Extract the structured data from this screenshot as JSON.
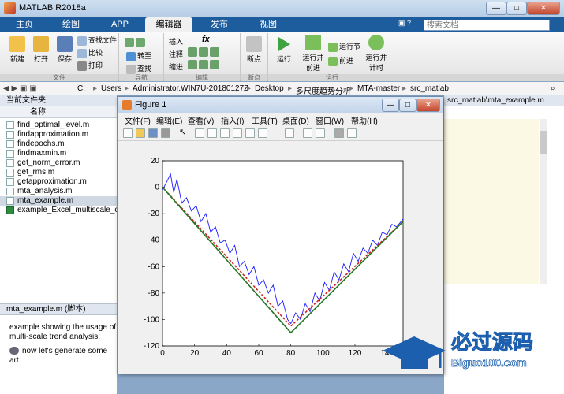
{
  "window": {
    "title": "MATLAB R2018a",
    "min": "—",
    "max": "□",
    "close": "✕"
  },
  "tabs": [
    {
      "label": "主页"
    },
    {
      "label": "绘图"
    },
    {
      "label": "APP"
    },
    {
      "label": "编辑器"
    },
    {
      "label": "发布"
    },
    {
      "label": "视图"
    }
  ],
  "search": {
    "placeholder": "搜索文档"
  },
  "ribbon": {
    "new": "新建",
    "open": "打开",
    "save": "保存",
    "find_files": "查找文件",
    "compare": "比较",
    "print": "打印",
    "insert": "插入",
    "fx": "fx",
    "goto": "转至",
    "comment": "注释",
    "find": "查找",
    "indent": "缩进",
    "breakpoint": "断点",
    "run": "运行",
    "run_advance": "运行并\n前进",
    "run_section": "运行节",
    "advance": "前进",
    "run_time": "运行并\n计时",
    "groups": {
      "file": "文件",
      "nav": "导航",
      "edit": "编辑",
      "bp": "断点",
      "run": "运行"
    }
  },
  "address": {
    "drive": "C:",
    "parts": [
      "Users",
      "Administrator.WIN7U-20180127Z",
      "Desktop",
      "多尺度趋势分析",
      "MTA-master",
      "src_matlab"
    ]
  },
  "current_folder": {
    "title": "当前文件夹",
    "col_name": "名称",
    "files": [
      "find_optimal_level.m",
      "findapproximation.m",
      "findepochs.m",
      "findmaxmin.m",
      "get_norm_error.m",
      "get_rms.m",
      "getapproximation.m",
      "mta_analysis.m",
      "mta_example.m",
      "example_Excel_multiscale_c"
    ],
    "selected": "mta_example.m"
  },
  "details": {
    "title": "mta_example.m (脚本)",
    "line1": "example showing the usage of",
    "line2": "multi-scale trend analysis;",
    "line3": "now let's generate some art"
  },
  "editor_tab": "src_matlab\\mta_example.m",
  "figure": {
    "title": "Figure 1",
    "menu": [
      "文件(F)",
      "编辑(E)",
      "查看(V)",
      "插入(I)",
      "工具(T)",
      "桌面(D)",
      "窗口(W)",
      "帮助(H)"
    ]
  },
  "chart_data": {
    "type": "line",
    "xlim": [
      0,
      150
    ],
    "ylim": [
      -120,
      20
    ],
    "xticks": [
      0,
      20,
      40,
      60,
      80,
      100,
      120,
      140
    ],
    "yticks": [
      20,
      0,
      -20,
      -40,
      -60,
      -80,
      -100,
      -120
    ],
    "series": [
      {
        "color": "#1a1aff",
        "x": [
          0,
          3,
          5,
          7,
          9,
          12,
          15,
          18,
          21,
          24,
          27,
          30,
          33,
          36,
          39,
          42,
          45,
          48,
          51,
          54,
          57,
          60,
          63,
          66,
          69,
          72,
          75,
          78,
          80,
          83,
          86,
          89,
          92,
          95,
          98,
          101,
          104,
          107,
          110,
          113,
          116,
          119,
          122,
          125,
          128,
          131,
          134,
          137,
          140,
          143,
          146,
          150
        ],
        "y": [
          -2,
          5,
          10,
          -4,
          6,
          -12,
          -8,
          -18,
          -14,
          -26,
          -20,
          -34,
          -30,
          -42,
          -40,
          -50,
          -44,
          -60,
          -56,
          -66,
          -60,
          -74,
          -70,
          -80,
          -74,
          -90,
          -86,
          -100,
          -103,
          -95,
          -100,
          -88,
          -94,
          -80,
          -86,
          -72,
          -78,
          -64,
          -70,
          -58,
          -64,
          -50,
          -56,
          -46,
          -50,
          -40,
          -44,
          -34,
          -36,
          -28,
          -30,
          -24
        ]
      },
      {
        "color": "#cc2222",
        "x": [
          0,
          80,
          150
        ],
        "y": [
          0,
          -105,
          -26
        ]
      },
      {
        "color": "#227722",
        "x": [
          0,
          80,
          150
        ],
        "y": [
          0,
          -110,
          -26
        ]
      }
    ]
  }
}
